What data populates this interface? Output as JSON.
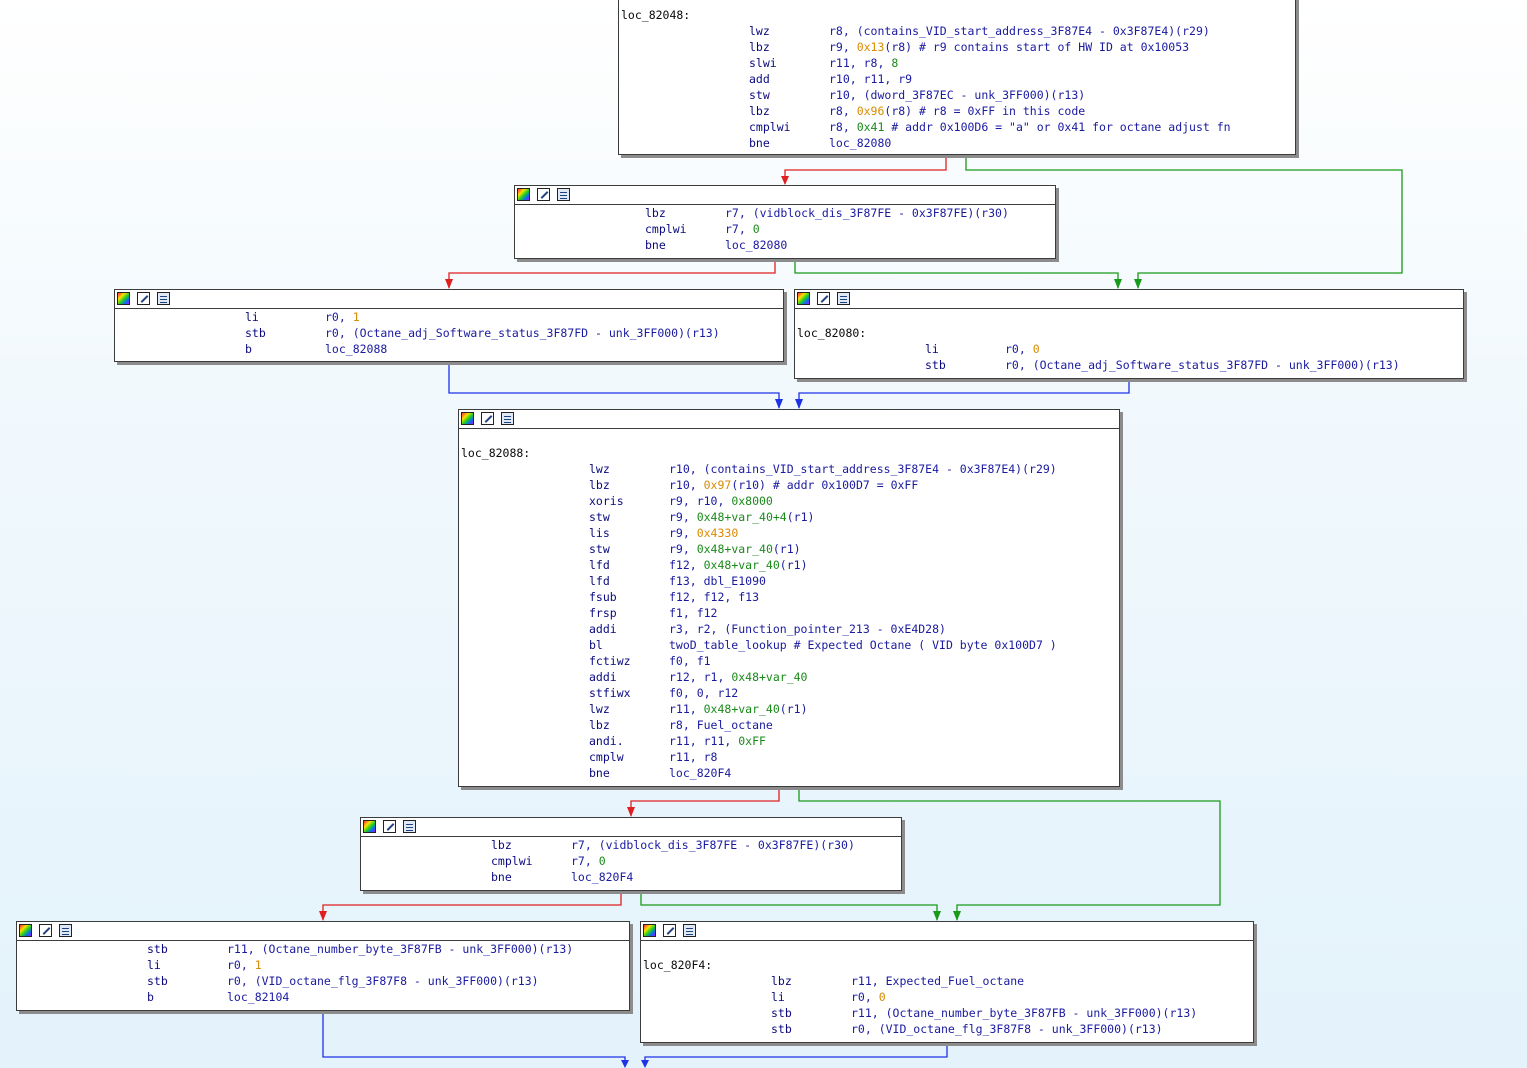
{
  "colors": {
    "edge_false": "#e02020",
    "edge_true": "#1a9a1a",
    "edge_jump": "#1e32e6",
    "text": "#0a0a80",
    "number": "#d98a00",
    "green_token": "#1a8a1a"
  },
  "icons": [
    "color-palette-icon",
    "edit-pencil-icon",
    "list-view-icon"
  ],
  "nodes": {
    "n0": {
      "label": "loc_82048:",
      "lines": [
        {
          "m": "lwz",
          "o": [
            [
              "r8, (contains_VID_start_address_3F87E4 - 0x3F87E4)(r29)",
              "t"
            ]
          ]
        },
        {
          "m": "lbz",
          "o": [
            [
              "r9, ",
              "t"
            ],
            [
              "0x13",
              "n"
            ],
            [
              "(r8) # r9 contains start of HW ID at 0x10053",
              "t"
            ]
          ]
        },
        {
          "m": "slwi",
          "o": [
            [
              "r11, r8, ",
              "t"
            ],
            [
              "8",
              "g"
            ]
          ]
        },
        {
          "m": "add",
          "o": [
            [
              "r10, r11, r9",
              "t"
            ]
          ]
        },
        {
          "m": "stw",
          "o": [
            [
              "r10, (dword_3F87EC - unk_3FF000)(r13)",
              "t"
            ]
          ]
        },
        {
          "m": "lbz",
          "o": [
            [
              "r8, ",
              "t"
            ],
            [
              "0x96",
              "n"
            ],
            [
              "(r8) # r8 = 0xFF in this code",
              "t"
            ]
          ]
        },
        {
          "m": "cmplwi",
          "o": [
            [
              "r8, ",
              "t"
            ],
            [
              "0x41",
              "g"
            ],
            [
              " # addr 0x100D6 = \"a\" or 0x41 for octane adjust fn",
              "t"
            ]
          ]
        },
        {
          "m": "bne",
          "o": [
            [
              "loc_82080",
              "t"
            ]
          ]
        }
      ]
    },
    "n1": {
      "lines": [
        {
          "m": "lbz",
          "o": [
            [
              "r7, (vidblock_dis_3F87FE - 0x3F87FE)(r30)",
              "t"
            ]
          ]
        },
        {
          "m": "cmplwi",
          "o": [
            [
              "r7, ",
              "t"
            ],
            [
              "0",
              "g"
            ]
          ]
        },
        {
          "m": "bne",
          "o": [
            [
              "loc_82080",
              "t"
            ]
          ]
        }
      ]
    },
    "n2": {
      "lines": [
        {
          "m": "li",
          "o": [
            [
              "r0, ",
              "t"
            ],
            [
              "1",
              "n"
            ]
          ]
        },
        {
          "m": "stb",
          "o": [
            [
              "r0, (Octane_adj_Software_status_3F87FD - unk_3FF000)(r13)",
              "t"
            ]
          ]
        },
        {
          "m": "b",
          "o": [
            [
              "loc_82088",
              "t"
            ]
          ]
        }
      ]
    },
    "n3": {
      "label": "loc_82080:",
      "lines": [
        {
          "m": "li",
          "o": [
            [
              "r0, ",
              "t"
            ],
            [
              "0",
              "n"
            ]
          ]
        },
        {
          "m": "stb",
          "o": [
            [
              "r0, (Octane_adj_Software_status_3F87FD - unk_3FF000)(r13)",
              "t"
            ]
          ]
        }
      ]
    },
    "n4": {
      "label": "loc_82088:",
      "lines": [
        {
          "m": "lwz",
          "o": [
            [
              "r10, (contains_VID_start_address_3F87E4 - 0x3F87E4)(r29)",
              "t"
            ]
          ]
        },
        {
          "m": "lbz",
          "o": [
            [
              "r10, ",
              "t"
            ],
            [
              "0x97",
              "n"
            ],
            [
              "(r10) # addr 0x100D7 = 0xFF",
              "t"
            ]
          ]
        },
        {
          "m": "xoris",
          "o": [
            [
              "r9, r10, ",
              "t"
            ],
            [
              "0x8000",
              "g"
            ]
          ]
        },
        {
          "m": "stw",
          "o": [
            [
              "r9, ",
              "t"
            ],
            [
              "0x48+var_40+4",
              "g"
            ],
            [
              "(r1)",
              "t"
            ]
          ]
        },
        {
          "m": "lis",
          "o": [
            [
              "r9, ",
              "t"
            ],
            [
              "0x4330",
              "n"
            ]
          ]
        },
        {
          "m": "stw",
          "o": [
            [
              "r9, ",
              "t"
            ],
            [
              "0x48+var_40",
              "g"
            ],
            [
              "(r1)",
              "t"
            ]
          ]
        },
        {
          "m": "lfd",
          "o": [
            [
              "f12, ",
              "t"
            ],
            [
              "0x48+var_40",
              "g"
            ],
            [
              "(r1)",
              "t"
            ]
          ]
        },
        {
          "m": "lfd",
          "o": [
            [
              "f13, dbl_E1090",
              "t"
            ]
          ]
        },
        {
          "m": "fsub",
          "o": [
            [
              "f12, f12, f13",
              "t"
            ]
          ]
        },
        {
          "m": "frsp",
          "o": [
            [
              "f1, f12",
              "t"
            ]
          ]
        },
        {
          "m": "addi",
          "o": [
            [
              "r3, r2, (Function_pointer_213 - 0xE4D28)",
              "t"
            ]
          ]
        },
        {
          "m": "bl",
          "o": [
            [
              "twoD_table_lookup # Expected Octane ( VID byte 0x100D7 )",
              "t"
            ]
          ]
        },
        {
          "m": "fctiwz",
          "o": [
            [
              "f0, f1",
              "t"
            ]
          ]
        },
        {
          "m": "addi",
          "o": [
            [
              "r12, r1, ",
              "t"
            ],
            [
              "0x48+var_40",
              "g"
            ]
          ]
        },
        {
          "m": "stfiwx",
          "o": [
            [
              "f0, 0, r12",
              "t"
            ]
          ]
        },
        {
          "m": "lwz",
          "o": [
            [
              "r11, ",
              "t"
            ],
            [
              "0x48+var_40",
              "g"
            ],
            [
              "(r1)",
              "t"
            ]
          ]
        },
        {
          "m": "lbz",
          "o": [
            [
              "r8, Fuel_octane",
              "t"
            ]
          ]
        },
        {
          "m": "andi.",
          "o": [
            [
              "r11, r11, ",
              "t"
            ],
            [
              "0xFF",
              "g"
            ]
          ]
        },
        {
          "m": "cmplw",
          "o": [
            [
              "r11, r8",
              "t"
            ]
          ]
        },
        {
          "m": "bne",
          "o": [
            [
              "loc_820F4",
              "t"
            ]
          ]
        }
      ]
    },
    "n5": {
      "lines": [
        {
          "m": "lbz",
          "o": [
            [
              "r7, (vidblock_dis_3F87FE - 0x3F87FE)(r30)",
              "t"
            ]
          ]
        },
        {
          "m": "cmplwi",
          "o": [
            [
              "r7, ",
              "t"
            ],
            [
              "0",
              "g"
            ]
          ]
        },
        {
          "m": "bne",
          "o": [
            [
              "loc_820F4",
              "t"
            ]
          ]
        }
      ]
    },
    "n6": {
      "lines": [
        {
          "m": "stb",
          "o": [
            [
              "r11, (Octane_number_byte_3F87FB - unk_3FF000)(r13)",
              "t"
            ]
          ]
        },
        {
          "m": "li",
          "o": [
            [
              "r0, ",
              "t"
            ],
            [
              "1",
              "n"
            ]
          ]
        },
        {
          "m": "stb",
          "o": [
            [
              "r0, (VID_octane_flg_3F87F8 - unk_3FF000)(r13)",
              "t"
            ]
          ]
        },
        {
          "m": "b",
          "o": [
            [
              "loc_82104",
              "t"
            ]
          ]
        }
      ]
    },
    "n7": {
      "label": "loc_820F4:",
      "lines": [
        {
          "m": "lbz",
          "o": [
            [
              "r11, Expected_Fuel_octane",
              "t"
            ]
          ]
        },
        {
          "m": "li",
          "o": [
            [
              "r0, ",
              "t"
            ],
            [
              "0",
              "n"
            ]
          ]
        },
        {
          "m": "stb",
          "o": [
            [
              "r11, (Octane_number_byte_3F87FB - unk_3FF000)(r13)",
              "t"
            ]
          ]
        },
        {
          "m": "stb",
          "o": [
            [
              "r0, (VID_octane_flg_3F87F8 - unk_3FF000)(r13)",
              "t"
            ]
          ]
        }
      ]
    }
  }
}
